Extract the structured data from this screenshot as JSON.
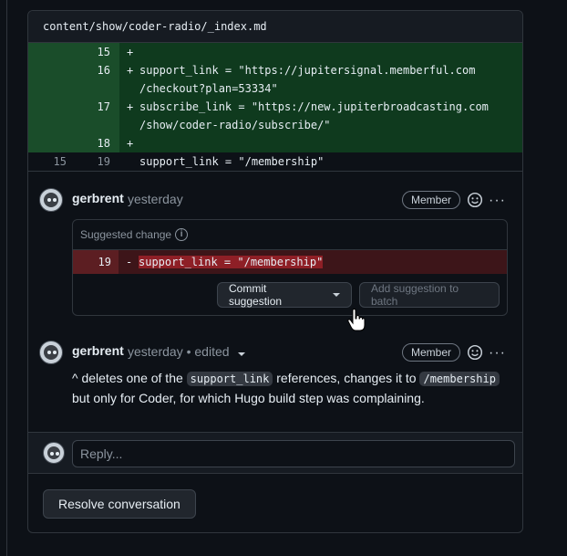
{
  "file": {
    "path": "content/show/coder-radio/_index.md"
  },
  "diff_lines": [
    {
      "old": "",
      "new": "15",
      "marker": "+",
      "text": "",
      "type": "add"
    },
    {
      "old": "",
      "new": "16",
      "marker": "+",
      "text": "support_link = \"https://jupitersignal.memberful.com\n/checkout?plan=53334\"",
      "type": "add"
    },
    {
      "old": "",
      "new": "17",
      "marker": "+",
      "text": "subscribe_link = \"https://new.jupiterbroadcasting.com\n/show/coder-radio/subscribe/\"",
      "type": "add"
    },
    {
      "old": "",
      "new": "18",
      "marker": "+",
      "text": "",
      "type": "add"
    },
    {
      "old": "15",
      "new": "19",
      "marker": "",
      "text": "support_link = \"/membership\"",
      "type": "ctx"
    }
  ],
  "comment1": {
    "author": "gerbrent",
    "time": "yesterday",
    "badge": "Member",
    "more": "···",
    "suggest_title": "Suggested change",
    "info": "i",
    "del_line": "19",
    "del_marker": "-",
    "del_text": "support_link = \"/membership\"",
    "commit_label": "Commit suggestion",
    "batch_label": "Add suggestion to batch"
  },
  "comment2": {
    "author": "gerbrent",
    "time": "yesterday",
    "edited": "• edited",
    "badge": "Member",
    "more": "···",
    "body_pre": "^ deletes one of the ",
    "code1": "support_link",
    "body_mid": " references, changes it to ",
    "code2": "/membership",
    "body_post": "but only for Coder, for which Hugo build step was complaining."
  },
  "reply": {
    "placeholder": "Reply..."
  },
  "resolve_label": "Resolve conversation"
}
